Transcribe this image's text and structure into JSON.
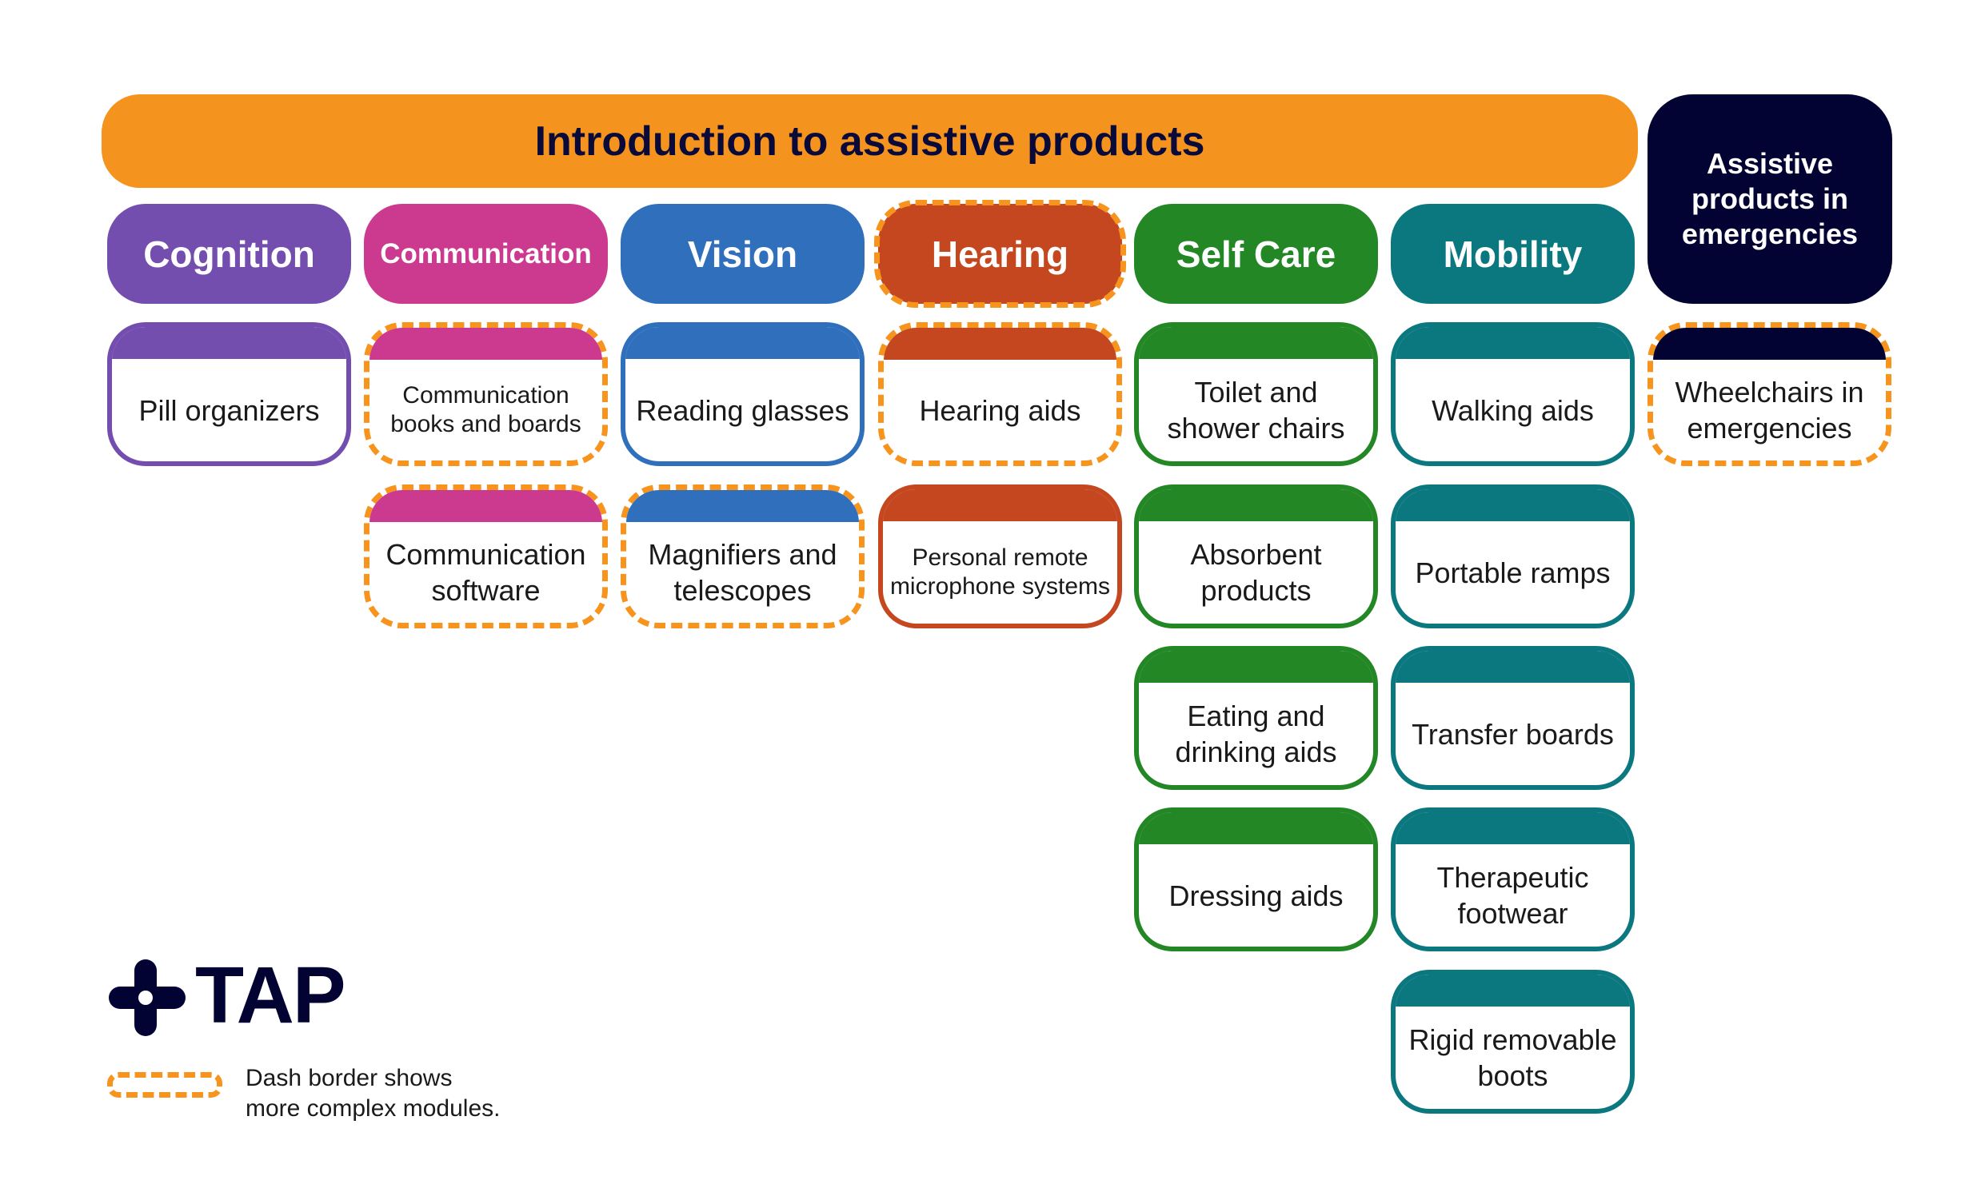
{
  "banner": {
    "title": "Introduction to assistive products",
    "color": "#F4941F"
  },
  "emergency": {
    "title": "Assistive products in emergencies",
    "color": "#020233",
    "modules": [
      {
        "label": "Wheelchairs in emergencies",
        "complex": true
      }
    ]
  },
  "categories": [
    {
      "name": "Cognition",
      "color": "#744EAE",
      "complex": false,
      "modules": [
        {
          "label": "Pill organizers",
          "complex": false
        }
      ]
    },
    {
      "name": "Communication",
      "color": "#CC3A8F",
      "complex": false,
      "modules": [
        {
          "label": "Communication books and boards",
          "complex": true
        },
        {
          "label": "Communication software",
          "complex": true
        }
      ]
    },
    {
      "name": "Vision",
      "color": "#2F6FBC",
      "complex": false,
      "modules": [
        {
          "label": "Reading glasses",
          "complex": false
        },
        {
          "label": "Magnifiers and telescopes",
          "complex": true
        }
      ]
    },
    {
      "name": "Hearing",
      "color": "#C4471F",
      "complex": true,
      "modules": [
        {
          "label": "Hearing aids",
          "complex": true
        },
        {
          "label": "Personal remote microphone systems",
          "complex": false
        }
      ]
    },
    {
      "name": "Self Care",
      "color": "#228724",
      "complex": false,
      "modules": [
        {
          "label": "Toilet and shower chairs",
          "complex": false
        },
        {
          "label": "Absorbent products",
          "complex": false
        },
        {
          "label": "Eating and drinking aids",
          "complex": false
        },
        {
          "label": "Dressing aids",
          "complex": false
        }
      ]
    },
    {
      "name": "Mobility",
      "color": "#0B7880",
      "complex": false,
      "modules": [
        {
          "label": "Walking aids",
          "complex": false
        },
        {
          "label": "Portable ramps",
          "complex": false
        },
        {
          "label": "Transfer boards",
          "complex": false
        },
        {
          "label": "Therapeutic footwear",
          "complex": false
        },
        {
          "label": "Rigid removable boots",
          "complex": false
        }
      ]
    }
  ],
  "logo": {
    "text": "TAP",
    "icon": "tap-cross-logo-icon",
    "color": "#020233"
  },
  "legend": {
    "dash_color": "#F7941D",
    "line1": "Dash border shows",
    "line2": "more complex modules."
  }
}
